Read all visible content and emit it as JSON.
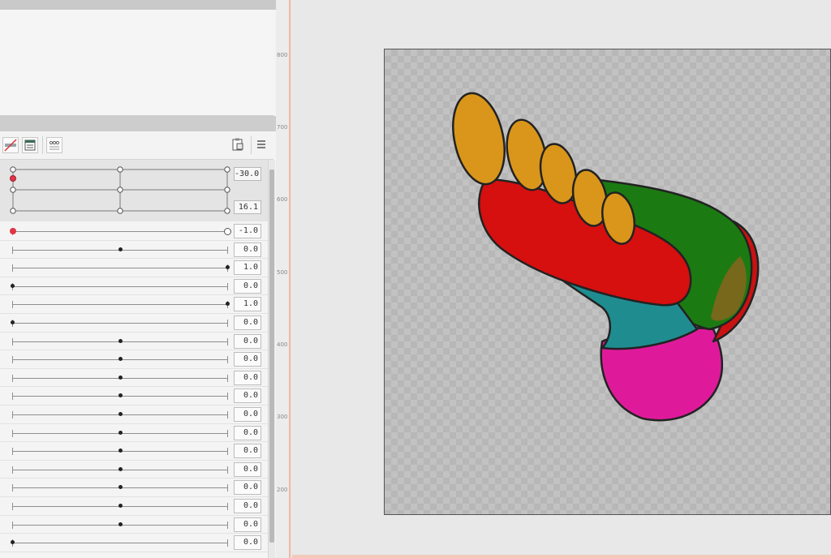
{
  "panel": {
    "grid_values": [
      "-30.0",
      "16.1"
    ],
    "rows": [
      {
        "value": "-1.0",
        "pos": 0.0,
        "style": "red-left-open-right"
      },
      {
        "value": "0.0",
        "pos": 0.5
      },
      {
        "value": "1.0",
        "pos": 1.0
      },
      {
        "value": "0.0",
        "pos": 0.0
      },
      {
        "value": "1.0",
        "pos": 1.0
      },
      {
        "value": "0.0",
        "pos": 0.0
      },
      {
        "value": "0.0",
        "pos": 0.5
      },
      {
        "value": "0.0",
        "pos": 0.5
      },
      {
        "value": "0.0",
        "pos": 0.5
      },
      {
        "value": "0.0",
        "pos": 0.5
      },
      {
        "value": "0.0",
        "pos": 0.5
      },
      {
        "value": "0.0",
        "pos": 0.5
      },
      {
        "value": "0.0",
        "pos": 0.5
      },
      {
        "value": "0.0",
        "pos": 0.5
      },
      {
        "value": "0.0",
        "pos": 0.5
      },
      {
        "value": "0.0",
        "pos": 0.5
      },
      {
        "value": "0.0",
        "pos": 0.5
      },
      {
        "value": "0.0",
        "pos": 0.0
      }
    ]
  },
  "ruler": {
    "labels": [
      "800",
      "700",
      "600",
      "500",
      "400",
      "300",
      "200"
    ]
  },
  "toolbar": {
    "icons": [
      "curve-toggle-icon",
      "list-view-icon",
      "link-points-icon",
      "clipboard-icon",
      "menu-icon"
    ]
  },
  "colors": {
    "accent_red": "#e03545",
    "ruler_border": "#f2b7a4",
    "foot_red": "#d60f0f",
    "foot_green": "#1c7a12",
    "foot_teal": "#1f8c90",
    "foot_pink": "#df1a9a",
    "foot_toes": "#d9961a"
  }
}
